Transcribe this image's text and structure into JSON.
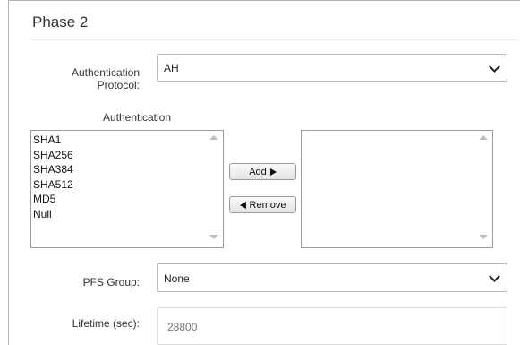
{
  "phase": {
    "title": "Phase 2"
  },
  "auth_protocol": {
    "label": "Authentication Protocol:",
    "value": "AH"
  },
  "authentication": {
    "heading": "Authentication",
    "available": [
      "SHA1",
      "SHA256",
      "SHA384",
      "SHA512",
      "MD5",
      "Null"
    ],
    "selected": []
  },
  "buttons": {
    "add_label": "Add",
    "remove_label": "Remove"
  },
  "pfs_group": {
    "label": "PFS Group:",
    "value": "None"
  },
  "lifetime": {
    "label": "Lifetime (sec):",
    "value": "28800"
  },
  "icons": {
    "dropdown": "chevron-down-icon",
    "add": "triangle-right-icon",
    "remove": "triangle-left-icon",
    "scroll_up": "scroll-up-arrow-icon",
    "scroll_down": "scroll-down-arrow-icon"
  }
}
